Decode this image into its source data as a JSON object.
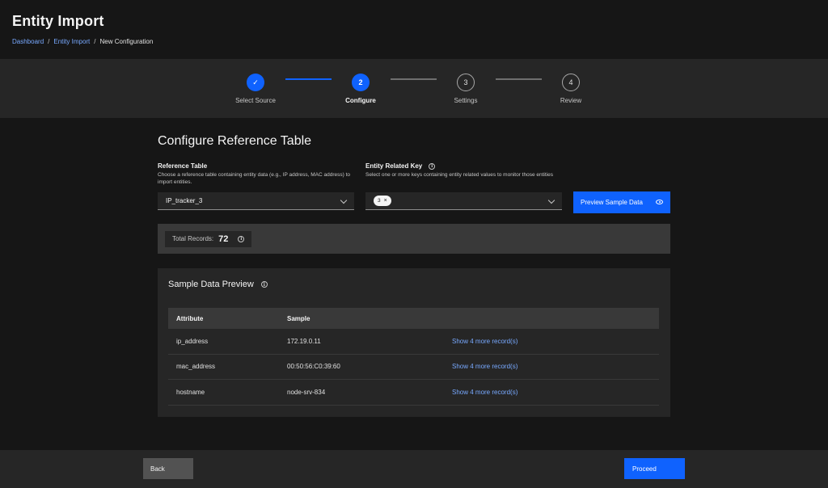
{
  "header": {
    "title": "Entity Import",
    "breadcrumb": [
      {
        "label": "Dashboard"
      },
      {
        "label": "Entity Import"
      },
      {
        "label": "New Configuration"
      }
    ],
    "separator": "/"
  },
  "stepper": {
    "steps": [
      {
        "number": "1",
        "label": "Select Source",
        "status": "complete"
      },
      {
        "number": "2",
        "label": "Configure",
        "status": "current"
      },
      {
        "number": "3",
        "label": "Settings",
        "status": "pending"
      },
      {
        "number": "4",
        "label": "Review",
        "status": "pending"
      }
    ],
    "check_glyph": "✓"
  },
  "main": {
    "section_title": "Configure Reference Table",
    "reference_table": {
      "label": "Reference Table",
      "help": "Choose a reference table containing entity data (e.g., IP address, MAC address) to import entities.",
      "value": "IP_tracker_3"
    },
    "entity_key": {
      "label": "Entity Related Key",
      "help": "Select one or more keys containing entity related values to monitor those entities",
      "tag_count": "3",
      "tag_close": "×"
    },
    "preview_button": "Preview Sample Data",
    "records": {
      "label": "Total Records:",
      "value": "72"
    },
    "sample": {
      "title": "Sample Data Preview",
      "columns": [
        "Attribute",
        "Sample"
      ],
      "rows": [
        {
          "attribute": "ip_address",
          "sample": "172.19.0.11",
          "more": "Show 4 more record(s)"
        },
        {
          "attribute": "mac_address",
          "sample": "00:50:56:C0:39:60",
          "more": "Show 4 more record(s)"
        },
        {
          "attribute": "hostname",
          "sample": "node-srv-834",
          "more": "Show 4 more record(s)"
        }
      ]
    }
  },
  "footer": {
    "back": "Back",
    "proceed": "Proceed"
  },
  "colors": {
    "accent": "#0f62fe",
    "link": "#78a9ff",
    "background": "#161616",
    "layer": "#262626"
  },
  "info_glyph": "i"
}
